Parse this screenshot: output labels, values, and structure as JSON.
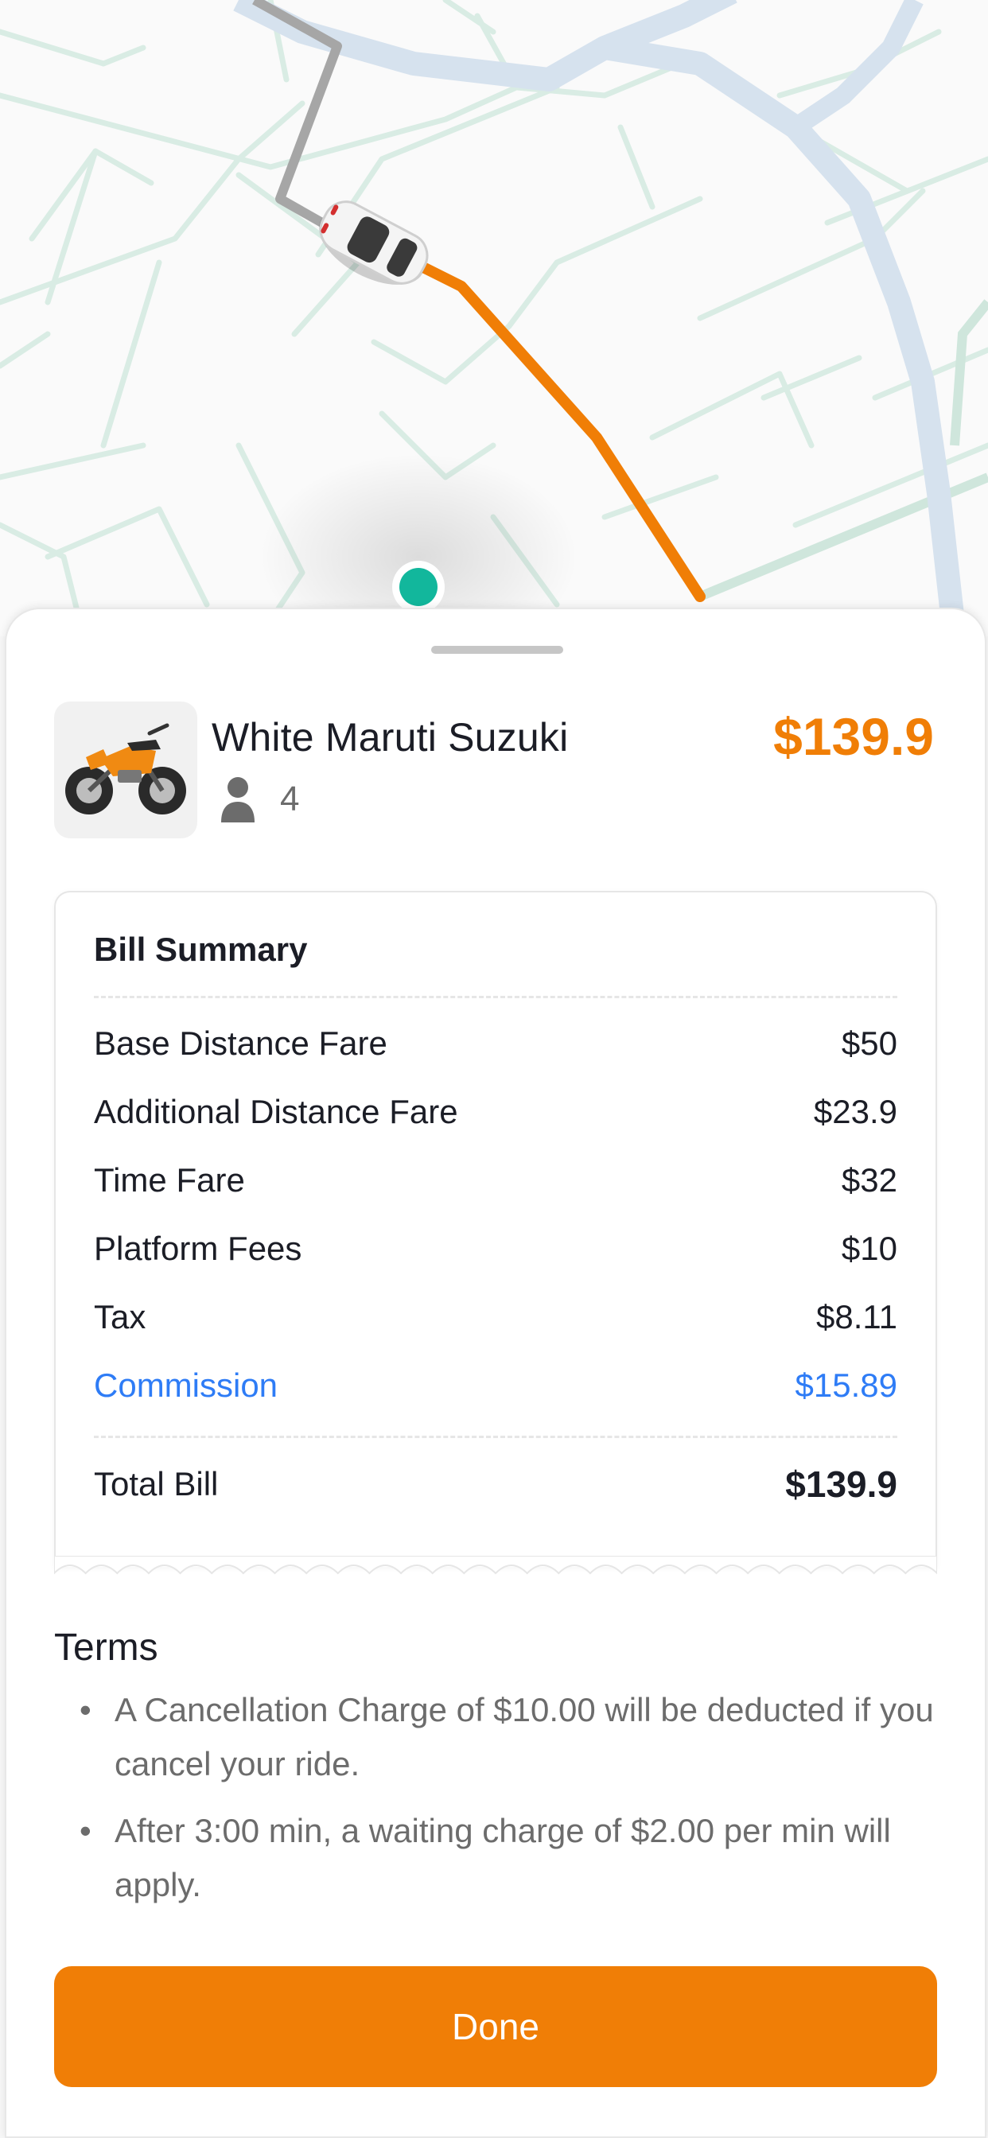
{
  "vehicle": {
    "name": "White Maruti Suzuki",
    "seats": "4",
    "price": "$139.9",
    "thumbnail_icon": "motorbike-icon"
  },
  "bill": {
    "title": "Bill Summary",
    "items": [
      {
        "label": "Base Distance Fare",
        "value": "$50"
      },
      {
        "label": "Additional Distance Fare",
        "value": "$23.9"
      },
      {
        "label": "Time Fare",
        "value": "$32"
      },
      {
        "label": "Platform Fees",
        "value": "$10"
      },
      {
        "label": "Tax",
        "value": "$8.11"
      },
      {
        "label": "Commission",
        "value": "$15.89"
      }
    ],
    "total_label": "Total Bill",
    "total_value": "$139.9"
  },
  "terms": {
    "title": "Terms",
    "items": [
      "A Cancellation Charge of $10.00 will be deducted if you cancel your ride.",
      "After 3:00 min, a waiting charge of $2.00 per min will apply."
    ],
    "bullet": "•"
  },
  "actions": {
    "done_label": "Done"
  },
  "colors": {
    "accent": "#f07e06",
    "commission_blue": "#2e7cf6",
    "route_orange": "#f07e06",
    "river": "#d6e2ee",
    "roads": "#d9ece4",
    "pickup_marker": "#12b79c"
  }
}
